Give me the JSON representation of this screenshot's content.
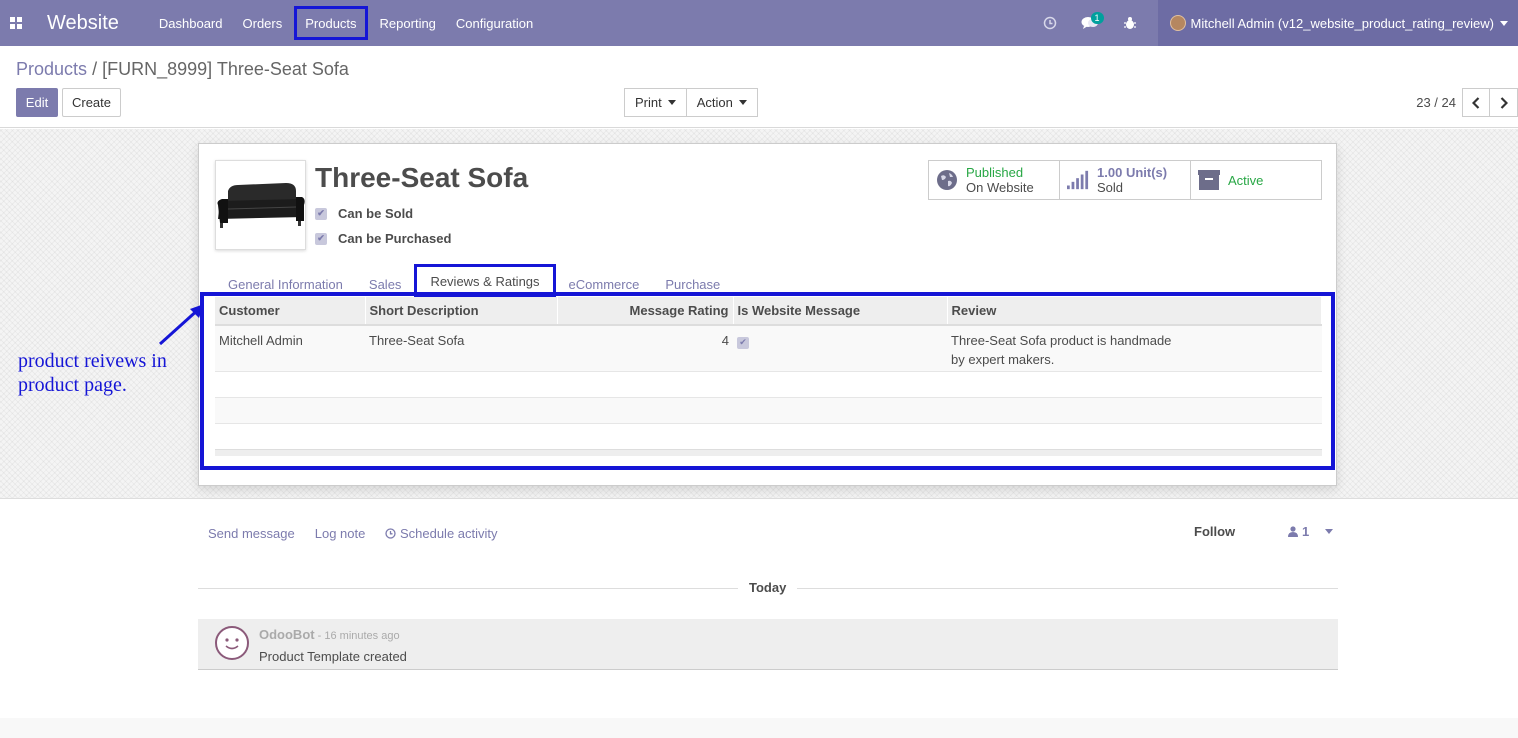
{
  "navbar": {
    "app_name": "Website",
    "menu": [
      "Dashboard",
      "Orders",
      "Products",
      "Reporting",
      "Configuration"
    ],
    "messages_count": "1",
    "user": "Mitchell Admin (v12_website_product_rating_review)",
    "bg_color": "#7c7bad"
  },
  "breadcrumb": {
    "parent": "Products",
    "separator": "/",
    "current": "[FURN_8999] Three-Seat Sofa"
  },
  "buttons": {
    "edit": "Edit",
    "create": "Create",
    "print": "Print",
    "action": "Action"
  },
  "pager": {
    "value": "23 / 24"
  },
  "product": {
    "name": "Three-Seat Sofa",
    "can_be_sold": "Can be Sold",
    "can_be_purchased": "Can be Purchased",
    "image_icon": "sofa-image"
  },
  "stats": {
    "published_label": "Published",
    "published_sub": "On Website",
    "sold_value": "1.00",
    "sold_unit": "Unit(s)",
    "sold_label": "Sold",
    "active_label": "Active"
  },
  "tabs": [
    "General Information",
    "Sales",
    "Reviews & Ratings",
    "eCommerce",
    "Purchase"
  ],
  "reviews_table": {
    "columns": [
      "Customer",
      "Short Description",
      "Message Rating",
      "Is Website Message",
      "Review"
    ],
    "rows": [
      {
        "customer": "Mitchell Admin",
        "short_description": "Three-Seat Sofa",
        "rating": "4",
        "is_website_message": true,
        "review_line1": "Three-Seat Sofa product is handmade",
        "review_line2": "by expert makers."
      }
    ]
  },
  "annotation": {
    "line1": "product reivews in",
    "line2": "product page.",
    "color": "#1515d6"
  },
  "chatter": {
    "send_message": "Send message",
    "log_note": "Log note",
    "schedule_activity": "Schedule activity",
    "follow": "Follow",
    "followers_count": "1",
    "today": "Today",
    "message": {
      "author": "OdooBot",
      "time": " - 16 minutes ago",
      "body": "Product Template created"
    }
  }
}
